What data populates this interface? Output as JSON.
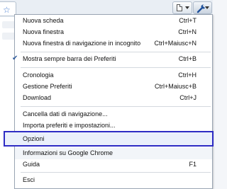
{
  "toolbar": {
    "page_icon": "page-icon",
    "wrench_icon": "wrench-icon"
  },
  "menu": {
    "items": [
      {
        "label": "Nuova scheda",
        "shortcut": "Ctrl+T"
      },
      {
        "label": "Nuova finestra",
        "shortcut": "Ctrl+N"
      },
      {
        "label": "Nuova finestra di navigazione in incognito",
        "shortcut": "Ctrl+Maiusc+N"
      },
      {
        "label": "Mostra sempre barra dei Preferiti",
        "shortcut": "Ctrl+B",
        "checked": true
      },
      {
        "label": "Cronologia",
        "shortcut": "Ctrl+H"
      },
      {
        "label": "Gestione Preferiti",
        "shortcut": "Ctrl+Maiusc+B"
      },
      {
        "label": "Download",
        "shortcut": "Ctrl+J"
      },
      {
        "label": "Cancella dati di navigazione...",
        "shortcut": ""
      },
      {
        "label": "Importa preferiti e impostazioni...",
        "shortcut": ""
      },
      {
        "label": "Opzioni",
        "shortcut": "",
        "highlighted": true
      },
      {
        "label": "Informazioni su Google Chrome",
        "shortcut": ""
      },
      {
        "label": "Guida",
        "shortcut": "F1"
      },
      {
        "label": "Esci",
        "shortcut": ""
      }
    ]
  },
  "colors": {
    "highlight_border": "#2e2cc4",
    "check": "#2f5b9c"
  }
}
